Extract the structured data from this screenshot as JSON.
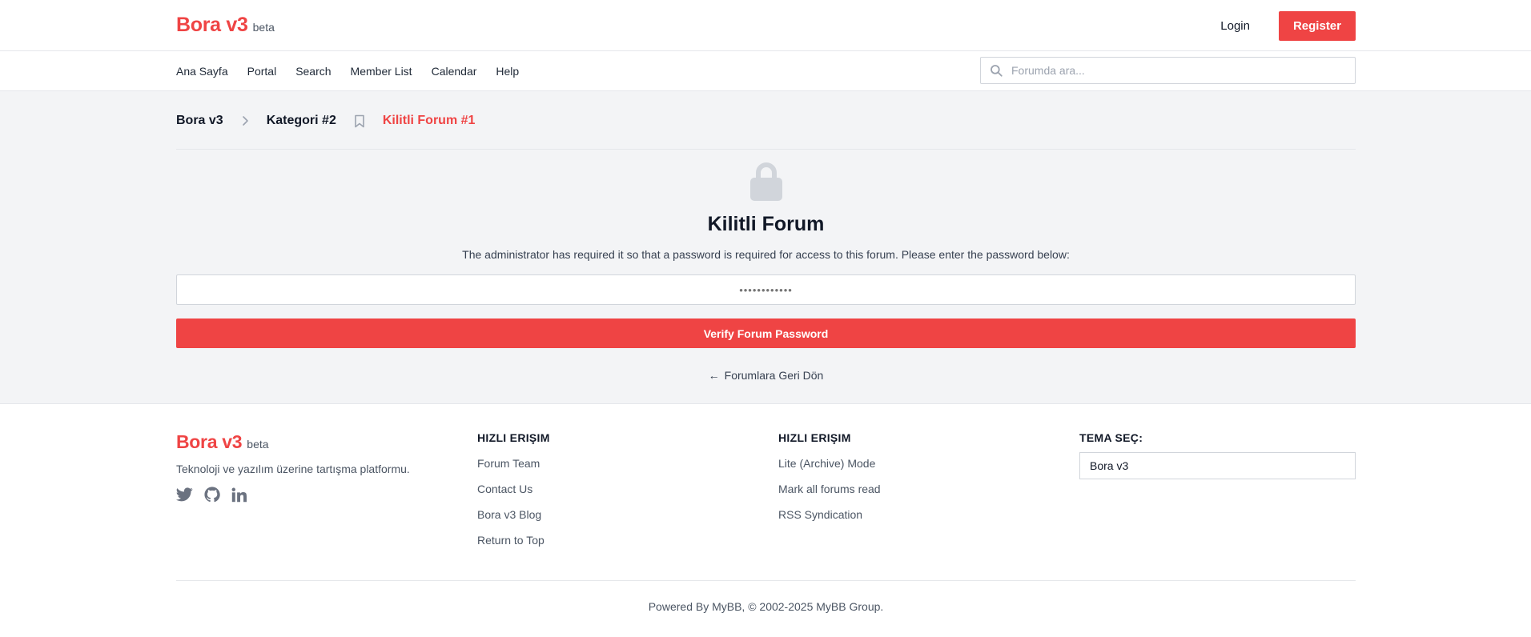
{
  "header": {
    "brand_name": "Bora v3",
    "brand_tag": "beta",
    "login_label": "Login",
    "register_label": "Register"
  },
  "nav": {
    "items": [
      "Ana Sayfa",
      "Portal",
      "Search",
      "Member List",
      "Calendar",
      "Help"
    ],
    "search_placeholder": "Forumda ara..."
  },
  "breadcrumb": {
    "items": [
      "Bora v3",
      "Kategori #2"
    ],
    "current": "Kilitli Forum #1"
  },
  "locked": {
    "title": "Kilitli Forum",
    "description": "The administrator has required it so that a password is required for access to this forum. Please enter the password below:",
    "password_placeholder": "••••••••••••",
    "verify_label": "Verify Forum Password",
    "back_label": "Forumlara Geri Dön",
    "back_arrow": "←"
  },
  "footer": {
    "brand_name": "Bora v3",
    "brand_tag": "beta",
    "tagline": "Teknoloji ve yazılım üzerine tartışma platformu.",
    "socials": [
      "twitter-icon",
      "github-icon",
      "linkedin-icon"
    ],
    "col1": {
      "heading": "HIZLI ERIŞIM",
      "links": [
        "Forum Team",
        "Contact Us",
        "Bora v3 Blog",
        "Return to Top"
      ]
    },
    "col2": {
      "heading": "HIZLI ERIŞIM",
      "links": [
        "Lite (Archive) Mode",
        "Mark all forums read",
        "RSS Syndication"
      ]
    },
    "theme": {
      "heading": "TEMA SEÇ:",
      "selected": "Bora v3"
    },
    "copyright": "Powered By MyBB, © 2002-2025 MyBB Group."
  },
  "colors": {
    "accent": "#ef4444",
    "background": "#f3f4f6",
    "text": "#111827",
    "muted": "#4b5563"
  }
}
